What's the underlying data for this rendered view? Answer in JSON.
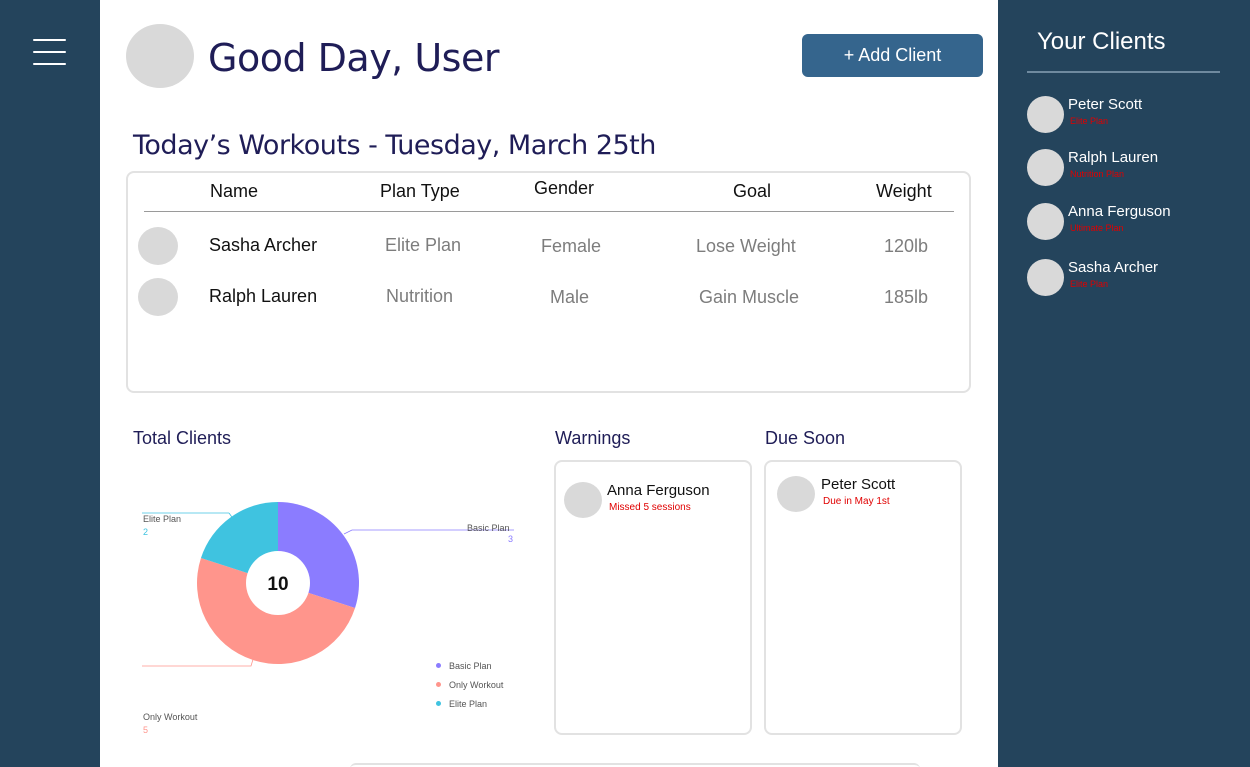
{
  "header": {
    "greeting": "Good Day, User",
    "add_client_label": "+ Add Client"
  },
  "workouts": {
    "title": "Today’s Workouts - Tuesday, March 25th",
    "columns": [
      "Name",
      "Plan Type",
      "Gender",
      "Goal",
      "Weight"
    ],
    "rows": [
      {
        "name": "Sasha Archer",
        "plan": "Elite Plan",
        "gender": "Female",
        "goal": "Lose Weight",
        "weight": "120lb"
      },
      {
        "name": "Ralph Lauren",
        "plan": "Nutrition",
        "gender": "Male",
        "goal": "Gain Muscle",
        "weight": "185lb"
      }
    ]
  },
  "total_clients": {
    "title": "Total Clients"
  },
  "chart_data": {
    "type": "pie",
    "donut": true,
    "center_label": "10",
    "slices": [
      {
        "label": "Basic Plan",
        "value": 3,
        "color": "#8b7cff"
      },
      {
        "label": "Only Workout",
        "value": 5,
        "color": "#ff958c"
      },
      {
        "label": "Elite Plan",
        "value": 2,
        "color": "#3fc3e0"
      }
    ],
    "legend": [
      "Basic Plan",
      "Only Workout",
      "Elite Plan"
    ],
    "legend_placement": "bottom-right"
  },
  "warnings": {
    "title": "Warnings",
    "items": [
      {
        "name": "Anna Ferguson",
        "note": "Missed 5 sessions"
      }
    ]
  },
  "due_soon": {
    "title": "Due Soon",
    "items": [
      {
        "name": "Peter Scott",
        "note": "Due in May 1st"
      }
    ]
  },
  "sidebar": {
    "title": "Your Clients",
    "clients": [
      {
        "name": "Peter Scott",
        "plan": "Elite Plan"
      },
      {
        "name": "Ralph Lauren",
        "plan": "Nutrition Plan"
      },
      {
        "name": "Anna Ferguson",
        "plan": "Ultimate Plan"
      },
      {
        "name": "Sasha Archer",
        "plan": "Elite Plan"
      }
    ]
  },
  "colors": {
    "navy": "#24445c",
    "button": "#35658d",
    "heading": "#1f1d57",
    "alert": "#e00000"
  },
  "icons": {
    "menu": "hamburger-menu-icon"
  }
}
